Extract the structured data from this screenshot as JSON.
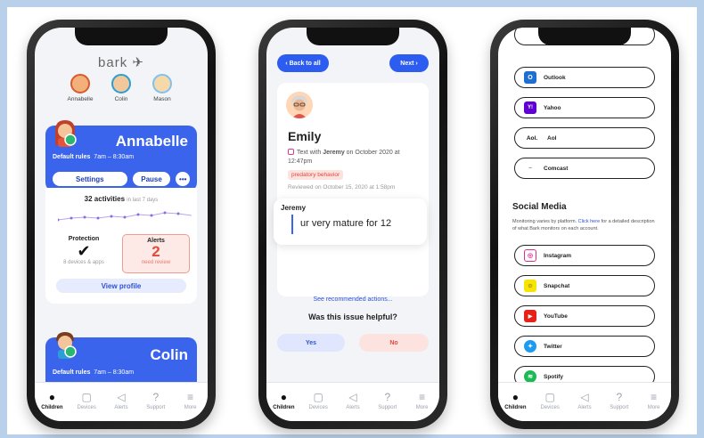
{
  "tabs": [
    {
      "label": "Children",
      "icon": "person-icon",
      "glyph": "●"
    },
    {
      "label": "Devices",
      "icon": "devices-icon",
      "glyph": "▢"
    },
    {
      "label": "Alerts",
      "icon": "megaphone-icon",
      "glyph": "◁"
    },
    {
      "label": "Support",
      "icon": "help-icon",
      "glyph": "?"
    },
    {
      "label": "More",
      "icon": "menu-icon",
      "glyph": "≡"
    }
  ],
  "phone1": {
    "logo": "bark",
    "children": [
      "Annabelle",
      "Colin",
      "Mason"
    ],
    "card1": {
      "name": "Annabelle",
      "rules_label": "Default rules",
      "rules_time": "7am – 8:30am",
      "settings": "Settings",
      "pause": "Pause",
      "more": "•••"
    },
    "activities": {
      "count": "32 activities",
      "period": "in last 7 days"
    },
    "protection": {
      "title": "Protection",
      "sub": "8 devices & apps"
    },
    "alerts": {
      "title": "Alerts",
      "count": "2",
      "sub": "need review"
    },
    "view_profile": "View profile",
    "card2": {
      "name": "Colin",
      "rules_label": "Default rules",
      "rules_time": "7am – 8:30am"
    }
  },
  "phone2": {
    "back": "‹ Back to all",
    "next": "Next ›",
    "name": "Emily",
    "meta_pre": "Text with ",
    "meta_who": "Jeremy",
    "meta_post": " on October 2020 at 12:47pm",
    "tag": "predatory behavior",
    "reviewed": "Reviewed on October 15, 2020 at 1:58pm",
    "msg_from": "Jeremy",
    "message": "ur very mature for 12",
    "see_actions": "See recommended actions...",
    "helpful_q": "Was this issue helpful?",
    "yes": "Yes",
    "no": "No"
  },
  "phone3": {
    "email_services": [
      {
        "name": "Outlook",
        "icon": "outlook-icon",
        "color": "#1f6fd1",
        "glyph": "O"
      },
      {
        "name": "Yahoo",
        "icon": "yahoo-icon",
        "color": "#5f01d1",
        "glyph": "Y!"
      },
      {
        "name": "Aol",
        "icon": "aol-icon",
        "color": "#ffffff",
        "glyph": "Aol."
      },
      {
        "name": "Comcast",
        "icon": "comcast-icon",
        "color": "#ffffff",
        "glyph": "~"
      }
    ],
    "social_title": "Social Media",
    "social_desc_pre": "Monitoring varies by platform. ",
    "social_desc_link": "Click here",
    "social_desc_post": " for a detailed description of what Bark monitors on each account.",
    "social_services": [
      {
        "name": "Instagram",
        "icon": "instagram-icon",
        "color": "#d62f8f",
        "glyph": "◎"
      },
      {
        "name": "Snapchat",
        "icon": "snapchat-icon",
        "color": "#f7e400",
        "glyph": "☺"
      },
      {
        "name": "YouTube",
        "icon": "youtube-icon",
        "color": "#e62117",
        "glyph": "▶"
      },
      {
        "name": "Twitter",
        "icon": "twitter-icon",
        "color": "#1d9bf0",
        "glyph": "✦"
      },
      {
        "name": "Spotify",
        "icon": "spotify-icon",
        "color": "#1db954",
        "glyph": "≋"
      }
    ]
  }
}
